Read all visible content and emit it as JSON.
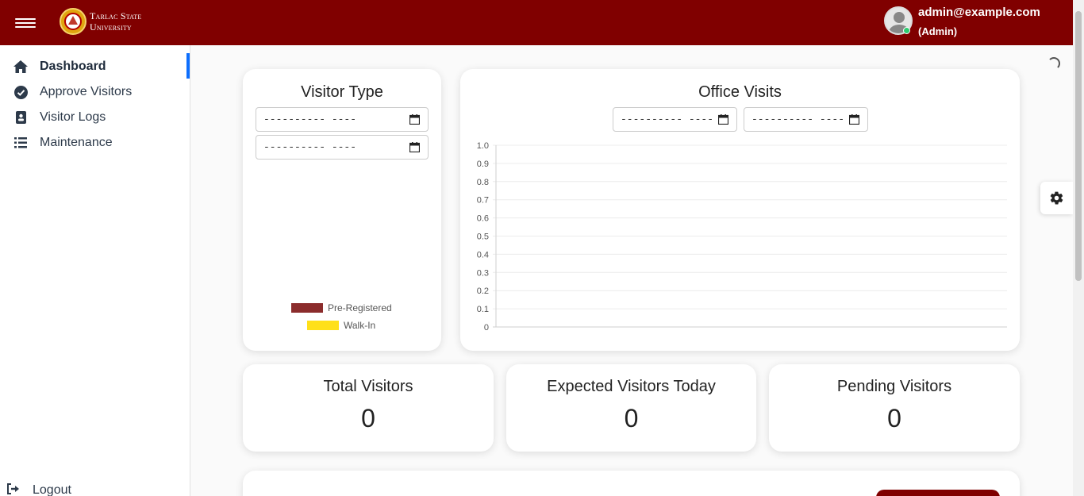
{
  "header": {
    "brand_line1": "Tarlac State",
    "brand_line2": "University",
    "user_email": "admin@example.com",
    "user_role": "(Admin)",
    "color": "#800000"
  },
  "sidebar": {
    "items": [
      {
        "label": "Dashboard",
        "icon": "home-icon",
        "active": true
      },
      {
        "label": "Approve Visitors",
        "icon": "check-circle-icon",
        "active": false
      },
      {
        "label": "Visitor Logs",
        "icon": "contact-book-icon",
        "active": false
      },
      {
        "label": "Maintenance",
        "icon": "list-icon",
        "active": false
      }
    ],
    "logout_label": "Logout"
  },
  "visitor_type": {
    "title": "Visitor Type",
    "date_from": "---------- ----",
    "date_to": "---------- ----",
    "legend": [
      {
        "label": "Pre-Registered",
        "color": "#8b2c2c"
      },
      {
        "label": "Walk-In",
        "color": "#ffe01a"
      }
    ]
  },
  "office_visits": {
    "title": "Office Visits",
    "date_from": "---------- ----",
    "date_to": "---------- ----"
  },
  "chart_data": {
    "type": "bar",
    "title": "Office Visits",
    "categories": [],
    "series": [],
    "ylim": [
      0,
      1.0
    ],
    "yticks": [
      "1.0",
      "0.9",
      "0.8",
      "0.7",
      "0.6",
      "0.5",
      "0.4",
      "0.3",
      "0.2",
      "0.1",
      "0"
    ],
    "grid": true
  },
  "stats": [
    {
      "title": "Total Visitors",
      "value": "0"
    },
    {
      "title": "Expected Visitors Today",
      "value": "0"
    },
    {
      "title": "Pending Visitors",
      "value": "0"
    }
  ]
}
